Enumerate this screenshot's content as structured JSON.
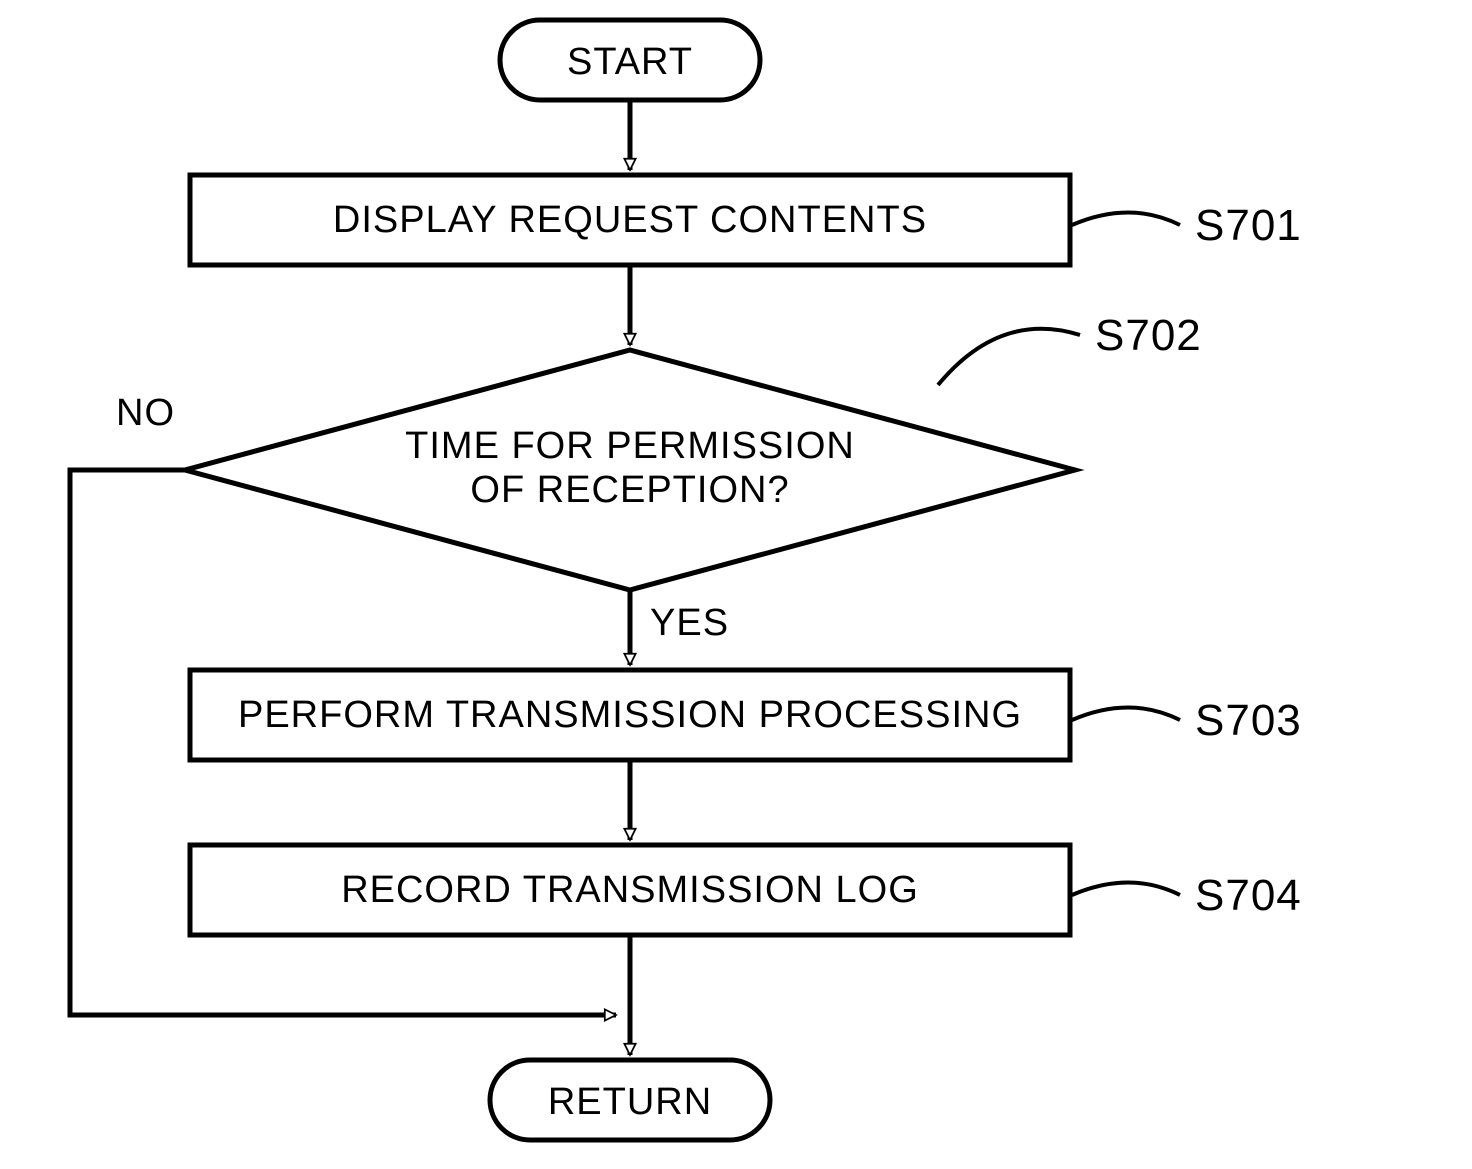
{
  "nodes": {
    "start": "START",
    "s701": "DISPLAY REQUEST CONTENTS",
    "s702_line1": "TIME FOR PERMISSION",
    "s702_line2": "OF RECEPTION?",
    "s703": "PERFORM TRANSMISSION PROCESSING",
    "s704": "RECORD TRANSMISSION LOG",
    "return": "RETURN"
  },
  "step_labels": {
    "s701": "S701",
    "s702": "S702",
    "s703": "S703",
    "s704": "S704"
  },
  "branches": {
    "yes": "YES",
    "no": "NO"
  }
}
